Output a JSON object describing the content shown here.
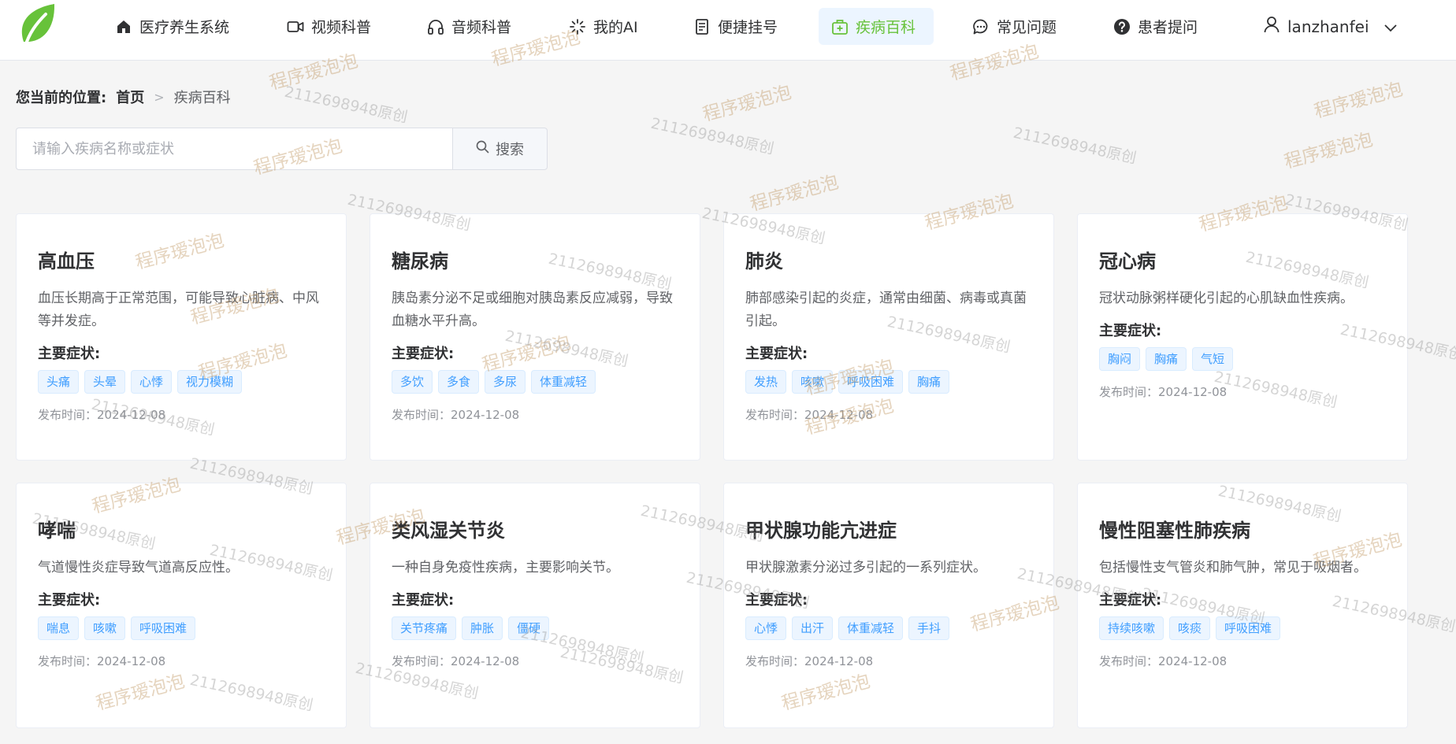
{
  "header": {
    "brand": "医疗养生系统",
    "nav": [
      {
        "label": "视频科普"
      },
      {
        "label": "音频科普"
      },
      {
        "label": "我的AI"
      },
      {
        "label": "便捷挂号"
      },
      {
        "label": "疾病百科"
      },
      {
        "label": "常见问题"
      },
      {
        "label": "患者提问"
      }
    ],
    "user": "lanzhanfei",
    "colors": {
      "brand": "#67c23a",
      "active_bg": "#ecf5ff"
    }
  },
  "breadcrumb": {
    "label": "您当前的位置:",
    "home": "首页",
    "current": "疾病百科"
  },
  "search": {
    "placeholder": "请输入疾病名称或症状",
    "value": "",
    "button": "搜索"
  },
  "symptoms_label": "主要症状:",
  "cards": [
    {
      "title": "高血压",
      "desc": "血压长期高于正常范围，可能导致心脏病、中风等并发症。",
      "tags": [
        "头痛",
        "头晕",
        "心悸",
        "视力模糊"
      ],
      "date": "发布时间：2024-12-08"
    },
    {
      "title": "糖尿病",
      "desc": "胰岛素分泌不足或细胞对胰岛素反应减弱，导致血糖水平升高。",
      "tags": [
        "多饮",
        "多食",
        "多尿",
        "体重减轻"
      ],
      "date": "发布时间：2024-12-08"
    },
    {
      "title": "肺炎",
      "desc": "肺部感染引起的炎症，通常由细菌、病毒或真菌引起。",
      "tags": [
        "发热",
        "咳嗽",
        "呼吸困难",
        "胸痛"
      ],
      "date": "发布时间：2024-12-08"
    },
    {
      "title": "冠心病",
      "desc": "冠状动脉粥样硬化引起的心肌缺血性疾病。",
      "tags": [
        "胸闷",
        "胸痛",
        "气短"
      ],
      "date": "发布时间：2024-12-08"
    },
    {
      "title": "哮喘",
      "desc": "气道慢性炎症导致气道高反应性。",
      "tags": [
        "喘息",
        "咳嗽",
        "呼吸困难"
      ],
      "date": "发布时间：2024-12-08"
    },
    {
      "title": "类风湿关节炎",
      "desc": "一种自身免疫性疾病，主要影响关节。",
      "tags": [
        "关节疼痛",
        "肿胀",
        "僵硬"
      ],
      "date": "发布时间：2024-12-08"
    },
    {
      "title": "甲状腺功能亢进症",
      "desc": "甲状腺激素分泌过多引起的一系列症状。",
      "tags": [
        "心悸",
        "出汗",
        "体重减轻",
        "手抖"
      ],
      "date": "发布时间：2024-12-08"
    },
    {
      "title": "慢性阻塞性肺疾病",
      "desc": "包括慢性支气管炎和肺气肿，常见于吸烟者。",
      "tags": [
        "持续咳嗽",
        "咳痰",
        "呼吸困难"
      ],
      "date": "发布时间：2024-12-08"
    }
  ],
  "watermark": {
    "text_a": "程序瑷泡泡",
    "text_b": "2112698948原创"
  }
}
